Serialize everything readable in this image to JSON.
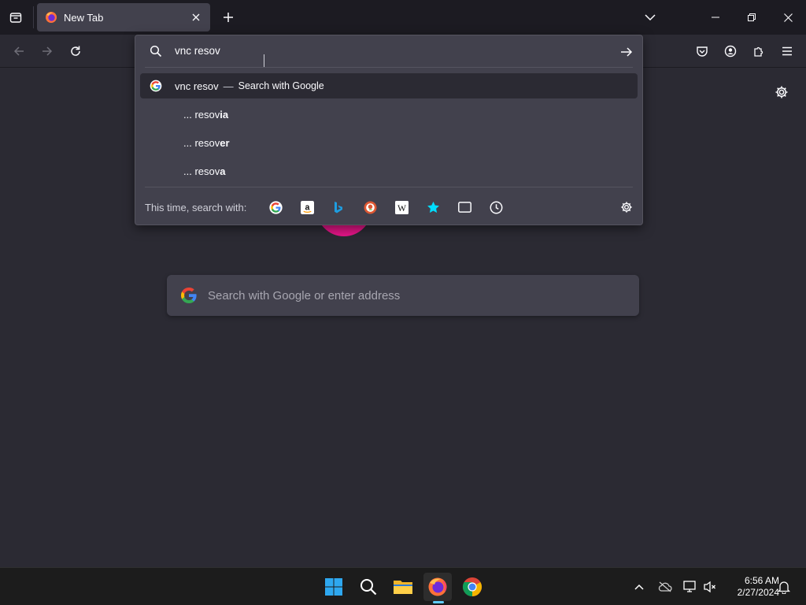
{
  "browser": {
    "tab": {
      "title": "New Tab"
    }
  },
  "urlbar": {
    "input_value": "vnc resov",
    "results": [
      {
        "query": "vnc resov",
        "separator": "—",
        "action": "Search with Google"
      }
    ],
    "suggestions": [
      {
        "prefix": "... resov",
        "completion": "ia"
      },
      {
        "prefix": "... resov",
        "completion": "er"
      },
      {
        "prefix": "... resov",
        "completion": "a"
      }
    ],
    "oneoff_label": "This time, search with:",
    "engines": [
      "google-icon",
      "amazon-icon",
      "bing-icon",
      "duckduckgo-icon",
      "wikipedia-icon",
      "bookmarks-icon",
      "tabs-icon",
      "history-icon"
    ]
  },
  "newtab": {
    "search_placeholder": "Search with Google or enter address"
  },
  "taskbar": {
    "time": "6:56 AM",
    "date": "2/27/2024",
    "apps": [
      "windows-start-icon",
      "search-icon",
      "file-explorer-icon",
      "firefox-icon",
      "chrome-icon"
    ]
  },
  "colors": {
    "background": "#2b2a33",
    "chrome": "#1c1b22",
    "panel": "#42414d",
    "accent": "#60cdff"
  }
}
